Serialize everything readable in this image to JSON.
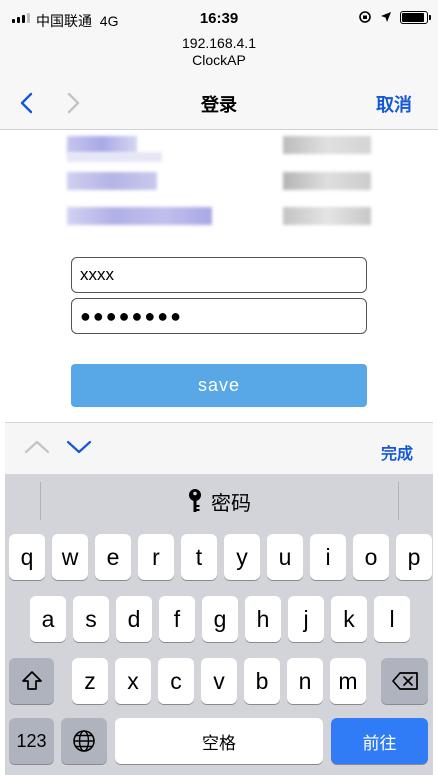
{
  "status_bar": {
    "carrier": "中国联通",
    "network": "4G",
    "time": "16:39"
  },
  "address": {
    "host": "192.168.4.1",
    "ssid": "ClockAP"
  },
  "nav": {
    "title": "登录",
    "cancel": "取消"
  },
  "form": {
    "username_value": "xxxx",
    "password_value": "●●●●●●●●",
    "save_label": "save"
  },
  "accessory": {
    "done_label": "完成"
  },
  "keyboard": {
    "suggestion": "密码",
    "row1": [
      "q",
      "w",
      "e",
      "r",
      "t",
      "y",
      "u",
      "i",
      "o",
      "p"
    ],
    "row2": [
      "a",
      "s",
      "d",
      "f",
      "g",
      "h",
      "j",
      "k",
      "l"
    ],
    "row3": [
      "z",
      "x",
      "c",
      "v",
      "b",
      "n",
      "m"
    ],
    "numbers_label": "123",
    "space_label": "空格",
    "go_label": "前往"
  },
  "colors": {
    "accent": "#1558d6",
    "save_button": "#58a8e8",
    "go_key": "#2f7cf6",
    "keyboard_bg": "#d2d4da"
  }
}
